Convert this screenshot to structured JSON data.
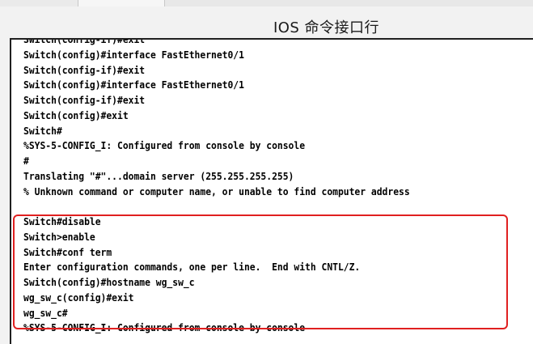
{
  "title": "IOS 命令接口行",
  "colors": {
    "highlight_border": "#e02020",
    "console_background": "#ffffff",
    "console_text": "#000000"
  },
  "console": {
    "lines": [
      "Switch(config-if)#exit",
      "Switch(config)#interface FastEthernet0/1",
      "Switch(config-if)#exit",
      "Switch(config)#interface FastEthernet0/1",
      "Switch(config-if)#exit",
      "Switch(config)#exit",
      "Switch#",
      "%SYS-5-CONFIG_I: Configured from console by console",
      "#",
      "Translating \"#\"...domain server (255.255.255.255)",
      "% Unknown command or computer name, or unable to find computer address",
      "",
      "Switch#disable",
      "Switch>enable",
      "Switch#conf term",
      "Enter configuration commands, one per line.  End with CNTL/Z.",
      "Switch(config)#hostname wg_sw_c",
      "wg_sw_c(config)#exit",
      "wg_sw_c#",
      "%SYS-5-CONFIG_I: Configured from console by console"
    ]
  }
}
